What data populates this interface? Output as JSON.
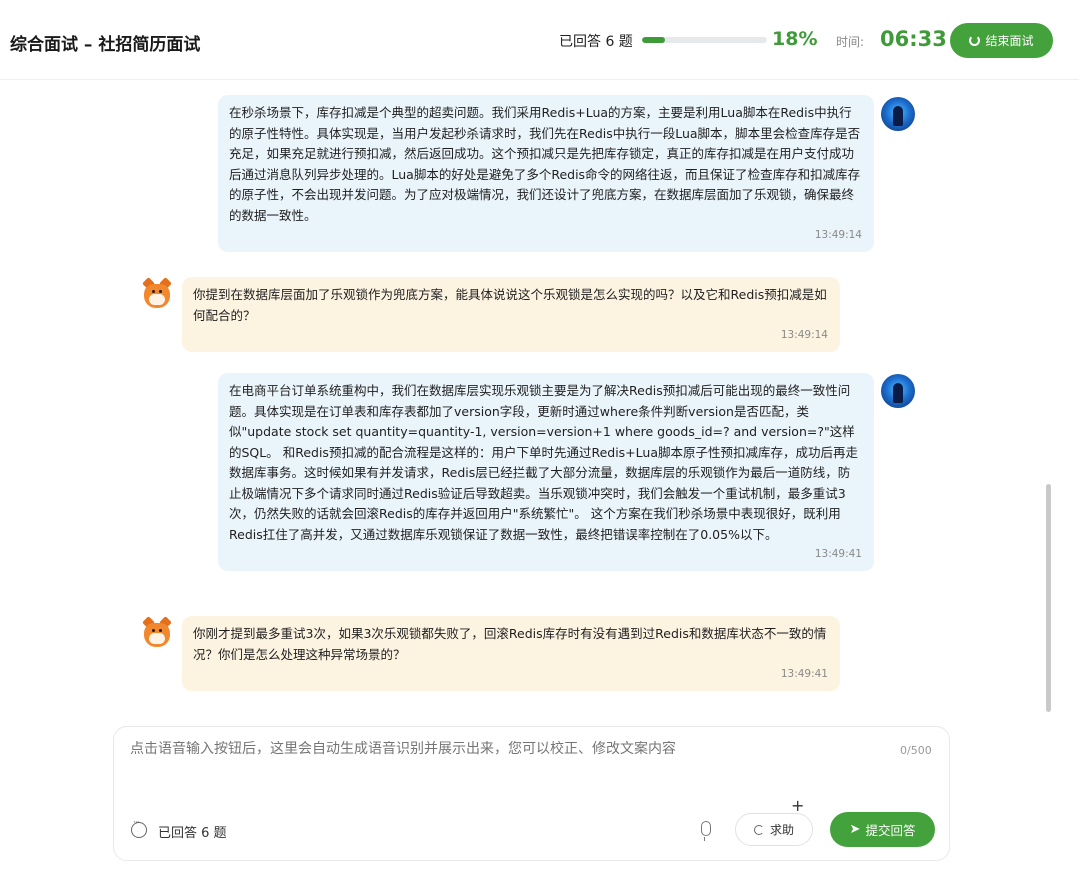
{
  "header": {
    "title": "综合面试 – 社招简历面试",
    "answered": "已回答 6 题",
    "progress_percent": 18,
    "progress_label": "18%",
    "time_label": "时间:",
    "time_value": "06:33",
    "end_button": "结束面试"
  },
  "messages": [
    {
      "role": "user",
      "text": "在秒杀场景下，库存扣减是个典型的超卖问题。我们采用Redis+Lua的方案，主要是利用Lua脚本在Redis中执行的原子性特性。具体实现是，当用户发起秒杀请求时，我们先在Redis中执行一段Lua脚本，脚本里会检查库存是否充足，如果充足就进行预扣减，然后返回成功。这个预扣减只是先把库存锁定，真正的库存扣减是在用户支付成功后通过消息队列异步处理的。Lua脚本的好处是避免了多个Redis命令的网络往返，而且保证了检查库存和扣减库存的原子性，不会出现并发问题。为了应对极端情况，我们还设计了兜底方案，在数据库层面加了乐观锁，确保最终的数据一致性。",
      "time": "13:49:14"
    },
    {
      "role": "bot",
      "text": "你提到在数据库层面加了乐观锁作为兜底方案，能具体说说这个乐观锁是怎么实现的吗？以及它和Redis预扣减是如何配合的？",
      "time": "13:49:14"
    },
    {
      "role": "user",
      "text": "在电商平台订单系统重构中，我们在数据库层实现乐观锁主要是为了解决Redis预扣减后可能出现的最终一致性问题。具体实现是在订单表和库存表都加了version字段，更新时通过where条件判断version是否匹配，类似\"update stock set quantity=quantity-1, version=version+1 where goods_id=? and version=?\"这样的SQL。 和Redis预扣减的配合流程是这样的：用户下单时先通过Redis+Lua脚本原子性预扣减库存，成功后再走数据库事务。这时候如果有并发请求，Redis层已经拦截了大部分流量，数据库层的乐观锁作为最后一道防线，防止极端情况下多个请求同时通过Redis验证后导致超卖。当乐观锁冲突时，我们会触发一个重试机制，最多重试3次，仍然失败的话就会回滚Redis的库存并返回用户\"系统繁忙\"。 这个方案在我们秒杀场景中表现很好，既利用Redis扛住了高并发，又通过数据库乐观锁保证了数据一致性，最终把错误率控制在了0.05%以下。",
      "time": "13:49:41"
    },
    {
      "role": "bot",
      "text": "你刚才提到最多重试3次，如果3次乐观锁都失败了，回滚Redis库存时有没有遇到过Redis和数据库状态不一致的情况？你们是怎么处理这种异常场景的？",
      "time": "13:49:41"
    }
  ],
  "composer": {
    "placeholder": "点击语音输入按钮后，这里会自动生成语音识别并展示出来，您可以校正、修改文案内容",
    "char_count": "0/500",
    "plus": "+",
    "answered": "已回答 6 题",
    "help_button": "求助",
    "submit_button": "提交回答"
  },
  "colors": {
    "accent": "#44a23c",
    "user_bubble": "#eaf4fb",
    "bot_bubble": "#fdf3e1"
  }
}
